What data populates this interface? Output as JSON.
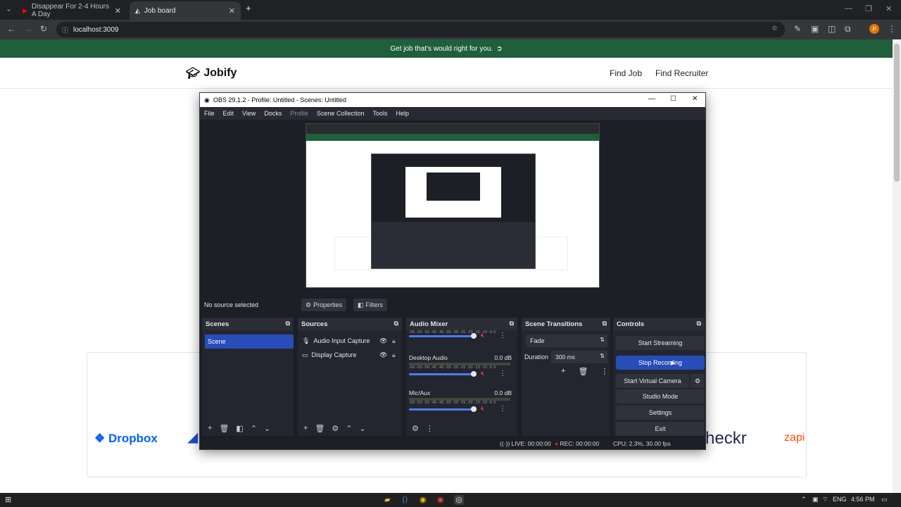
{
  "browser": {
    "tabs": [
      {
        "title": "Disappear For 2-4 Hours A Day",
        "icon": "youtube-icon",
        "close": "✕"
      },
      {
        "title": "Job board",
        "icon": "page-icon",
        "close": "✕"
      }
    ],
    "new_tab": "+",
    "url": "localhost:3009",
    "profile_initial": "P"
  },
  "page": {
    "banner_text": "Get job that's would right for you.",
    "logo_text": "Jobify",
    "nav": [
      "Find Job",
      "Find Recruiter"
    ],
    "companies": [
      "Dropbox",
      "heckr",
      "zapi"
    ]
  },
  "obs": {
    "title": "OBS 29.1.2 - Profile: Untitled - Scenes: Untitled",
    "menu": [
      "File",
      "Edit",
      "View",
      "Docks",
      "Profile",
      "Scene Collection",
      "Tools",
      "Help"
    ],
    "no_source": "No source selected",
    "properties_label": "Properties",
    "filters_label": "Filters",
    "scenes": {
      "title": "Scenes",
      "items": [
        "Scene"
      ]
    },
    "sources": {
      "title": "Sources",
      "items": [
        "Audio Input Capture",
        "Display Capture"
      ]
    },
    "mixer": {
      "title": "Audio Mixer",
      "channels": [
        {
          "name": "",
          "db": ""
        },
        {
          "name": "Desktop Audio",
          "db": "0.0 dB"
        },
        {
          "name": "Mic/Aux",
          "db": "0.0 dB"
        }
      ],
      "scale": "-60 -55 -50 -45 -40 -35 -30 -25 -20 -15 -10 -5 0"
    },
    "transitions": {
      "title": "Scene Transitions",
      "selected": "Fade",
      "duration_label": "Duration",
      "duration_value": "300 ms"
    },
    "controls": {
      "title": "Controls",
      "buttons": [
        "Start Streaming",
        "Stop Recording",
        "Start Virtual Camera",
        "Studio Mode",
        "Settings",
        "Exit"
      ]
    },
    "status": {
      "live": "LIVE: 00:00:00",
      "rec": "REC: 00:00:00",
      "cpu": "CPU: 2.3%, 30.00 fps"
    }
  },
  "taskbar": {
    "lang": "ENG",
    "time": "4:56 PM"
  }
}
